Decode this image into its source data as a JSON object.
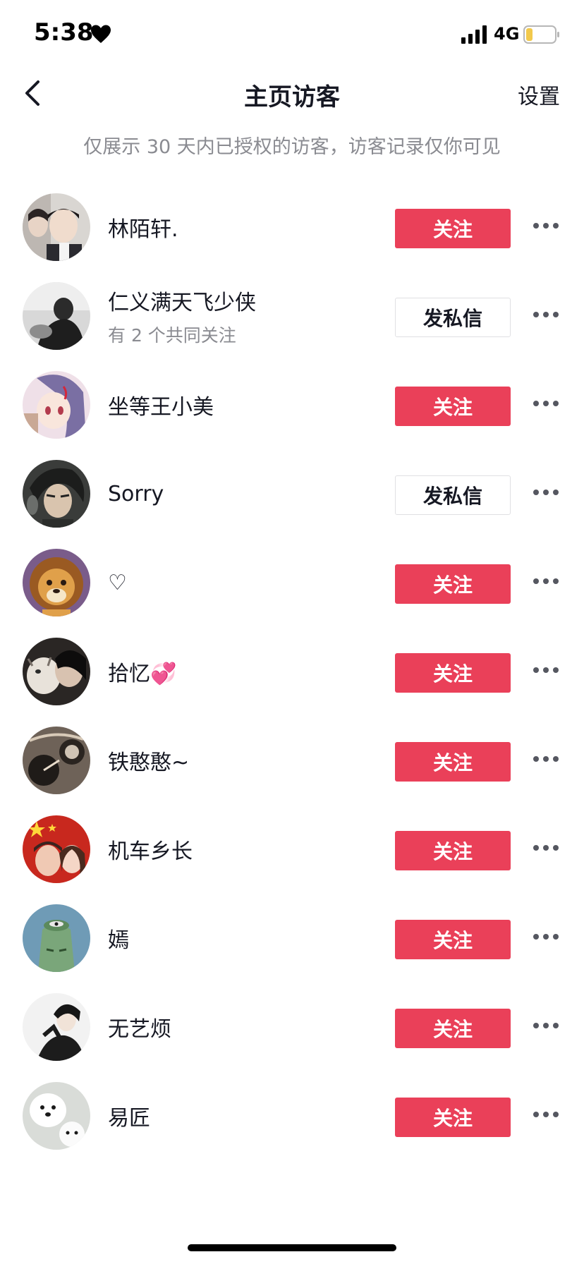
{
  "status_bar": {
    "time": "5:38",
    "network": "4G"
  },
  "nav": {
    "title": "主页访客",
    "settings_label": "设置"
  },
  "notice": "仅展示 30 天内已授权的访客，访客记录仅你可见",
  "visitors": [
    {
      "name": "林陌轩.",
      "subtitle": "",
      "action": "关注"
    },
    {
      "name": "仁义满天飞少侠",
      "subtitle": "有 2 个共同关注",
      "action": "发私信"
    },
    {
      "name": "坐等王小美",
      "subtitle": "",
      "action": "关注"
    },
    {
      "name": "Sorry",
      "subtitle": "",
      "action": "发私信"
    },
    {
      "name": "♡",
      "subtitle": "",
      "action": "关注"
    },
    {
      "name": "拾忆💞",
      "subtitle": "",
      "action": "关注"
    },
    {
      "name": "铁憨憨~",
      "subtitle": "",
      "action": "关注"
    },
    {
      "name": "机车乡长",
      "subtitle": "",
      "action": "关注"
    },
    {
      "name": "嫣",
      "subtitle": "",
      "action": "关注"
    },
    {
      "name": "无艺烦",
      "subtitle": "",
      "action": "关注"
    },
    {
      "name": "易匠",
      "subtitle": "",
      "action": "关注"
    }
  ],
  "colors": {
    "follow_button": "#ea4059",
    "secondary_text": "#8a8b91"
  }
}
